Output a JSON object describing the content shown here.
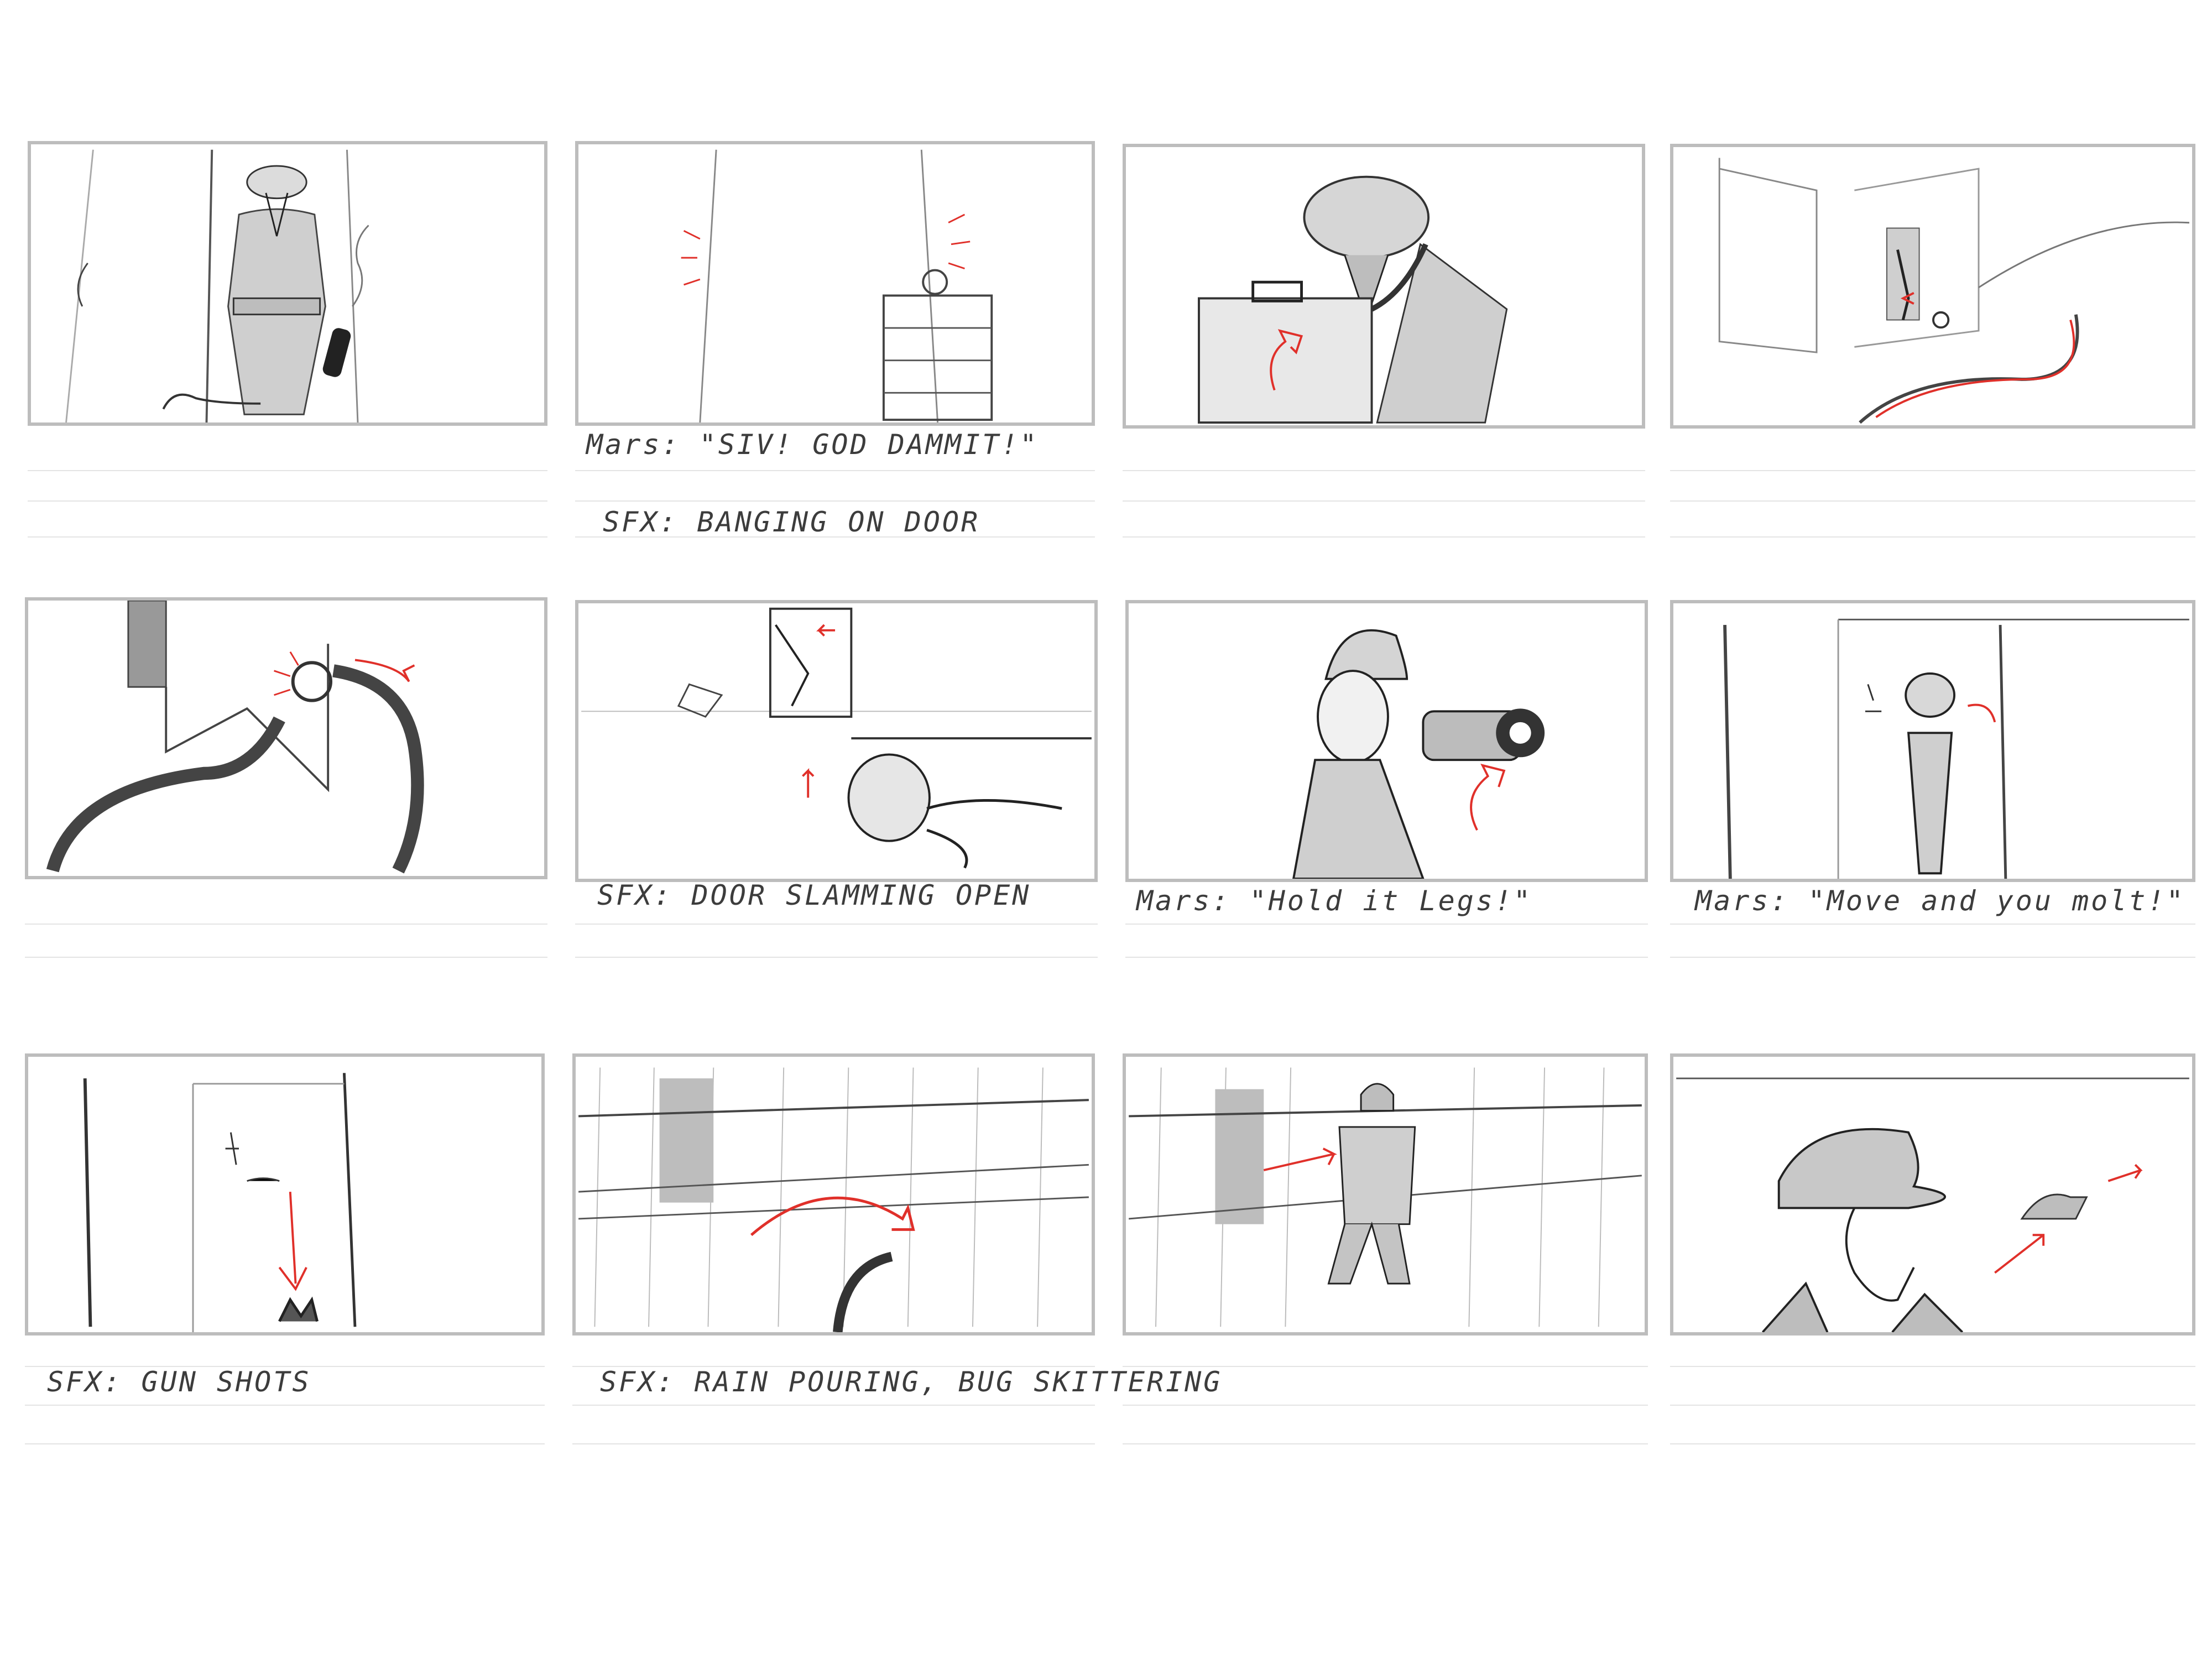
{
  "storyboard": {
    "panels": [
      {
        "label": "panel-1",
        "notes": []
      },
      {
        "label": "panel-2",
        "notes": [
          "Mars: \"SIV! GOD DAMMIT!\"",
          "SFX: BANGING ON DOOR"
        ]
      },
      {
        "label": "panel-3",
        "notes": []
      },
      {
        "label": "panel-4",
        "notes": []
      },
      {
        "label": "panel-5",
        "notes": []
      },
      {
        "label": "panel-6",
        "notes": [
          "SFX: DOOR SLAMMING OPEN"
        ]
      },
      {
        "label": "panel-7",
        "notes": [
          "Mars: \"Hold it Legs!\""
        ]
      },
      {
        "label": "panel-8",
        "notes": [
          "Mars: \"Move and you molt!\""
        ]
      },
      {
        "label": "panel-9",
        "notes": [
          "SFX: GUN SHOTS"
        ]
      },
      {
        "label": "panel-10",
        "notes": [
          "SFX: RAIN POURING, BUG SKITTERING"
        ]
      },
      {
        "label": "panel-11",
        "notes": []
      },
      {
        "label": "panel-12",
        "notes": []
      }
    ],
    "colors": {
      "pencil": "#3a3a3a",
      "shade": "#cfcfcf",
      "accent": "#e0302a",
      "frame": "#bdbdbd"
    }
  }
}
